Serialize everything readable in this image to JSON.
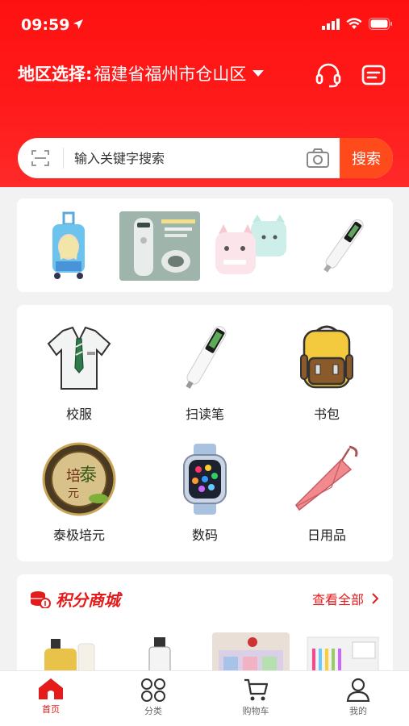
{
  "status_bar": {
    "time": "09:59"
  },
  "header": {
    "region_label": "地区选择:",
    "region_value": "福建省福州市仓山区"
  },
  "search": {
    "placeholder": "输入关键字搜索",
    "button_label": "搜索"
  },
  "banner": {
    "items": [
      {
        "name": "儿童拉杆箱"
      },
      {
        "name": "温显与科技 灵魂碰撞"
      },
      {
        "name": "猫耳迷你打印机"
      },
      {
        "name": "扫读笔"
      }
    ]
  },
  "categories": [
    {
      "label": "校服",
      "icon": "shirt-icon"
    },
    {
      "label": "扫读笔",
      "icon": "scan-pen-icon"
    },
    {
      "label": "书包",
      "icon": "backpack-icon"
    },
    {
      "label": "泰极培元",
      "icon": "taiji-badge-icon"
    },
    {
      "label": "数码",
      "icon": "smartwatch-icon"
    },
    {
      "label": "日用品",
      "icon": "umbrella-icon"
    }
  ],
  "points_mall": {
    "title": "积分商城",
    "view_all": "查看全部"
  },
  "tabbar": [
    {
      "label": "首页",
      "icon": "home-icon",
      "active": true
    },
    {
      "label": "分类",
      "icon": "category-icon",
      "active": false
    },
    {
      "label": "购物车",
      "icon": "cart-icon",
      "active": false
    },
    {
      "label": "我的",
      "icon": "profile-icon",
      "active": false
    }
  ],
  "colors": {
    "brand_red": "#ff1a1a",
    "accent_red": "#e51b1b",
    "search_button": "#ff4a1c"
  }
}
